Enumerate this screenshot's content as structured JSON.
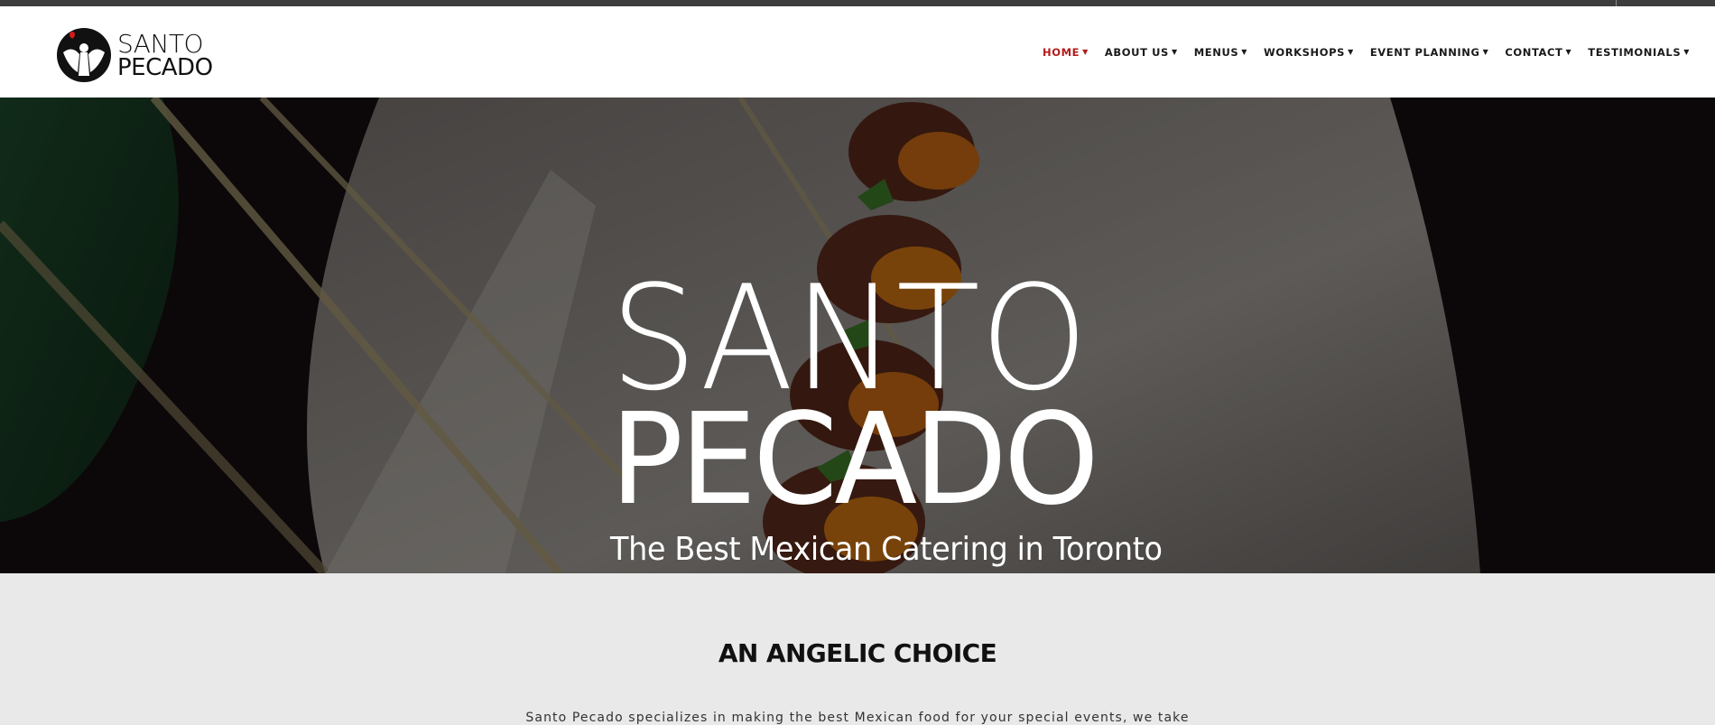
{
  "header": {
    "logo": {
      "line1": "SANTO",
      "line2": "PECADO"
    },
    "nav": [
      {
        "label": "HOME",
        "active": true
      },
      {
        "label": "ABOUT US",
        "active": false
      },
      {
        "label": "MENUS",
        "active": false
      },
      {
        "label": "WORKSHOPS",
        "active": false
      },
      {
        "label": "EVENT PLANNING",
        "active": false
      },
      {
        "label": "CONTACT",
        "active": false
      },
      {
        "label": "TESTIMONIALS",
        "active": false
      }
    ],
    "caret_icon": "caret-down-icon"
  },
  "hero": {
    "line1": "SANTO",
    "line2": "PECADO",
    "subtitle": "The Best Mexican Catering in Toronto"
  },
  "intro": {
    "title": "AN ANGELIC CHOICE",
    "text": "Santo Pecado specializes in making the best Mexican food for your special events, we take"
  },
  "colors": {
    "accent": "#b31b1b",
    "topbar": "#3d3d3d",
    "section_bg": "#e9e9e9"
  }
}
